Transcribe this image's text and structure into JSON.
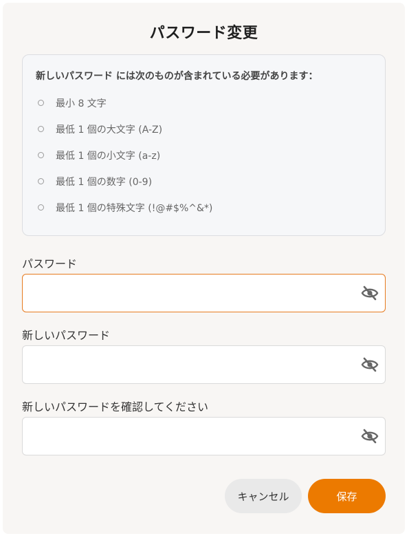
{
  "dialog": {
    "title": "パスワード変更"
  },
  "requirements": {
    "heading": "新しいパスワード には次のものが含まれている必要があります：",
    "items": [
      {
        "label": "最小 8 文字",
        "met": false
      },
      {
        "label": "最低 1 個の大文字 (A-Z)",
        "met": false
      },
      {
        "label": "最低 1 個の小文字 (a-z)",
        "met": false
      },
      {
        "label": "最低 1 個の数字 (0-9)",
        "met": false
      },
      {
        "label": "最低 1 個の特殊文字 (!@#$%^&*)",
        "met": false
      }
    ]
  },
  "fields": {
    "current_password": {
      "label": "パスワード",
      "value": "",
      "focused": true,
      "icon": "eye-slash-icon"
    },
    "new_password": {
      "label": "新しいパスワード",
      "value": "",
      "focused": false,
      "icon": "eye-slash-icon"
    },
    "confirm_password": {
      "label": "新しいパスワードを確認してください",
      "value": "",
      "focused": false,
      "icon": "eye-slash-icon"
    }
  },
  "buttons": {
    "cancel_label": "キャンセル",
    "save_label": "保存"
  },
  "colors": {
    "accent": "#ec7a00",
    "focus_border": "#e67a1e",
    "dialog_background": "#f8f6f4"
  }
}
